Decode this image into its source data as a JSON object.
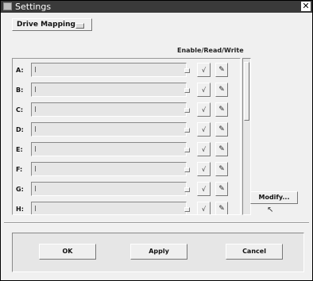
{
  "window": {
    "title": "Settings",
    "close_glyph": "✕"
  },
  "option_menu": {
    "label": "Drive Mapping"
  },
  "column_header": "Enable/Read/Write",
  "drives": [
    {
      "letter": "A:",
      "ro": "√",
      "rw": "✎"
    },
    {
      "letter": "B:",
      "ro": "√",
      "rw": "✎"
    },
    {
      "letter": "C:",
      "ro": "√",
      "rw": "✎"
    },
    {
      "letter": "D:",
      "ro": "√",
      "rw": "✎"
    },
    {
      "letter": "E:",
      "ro": "√",
      "rw": "✎"
    },
    {
      "letter": "F:",
      "ro": "√",
      "rw": "✎"
    },
    {
      "letter": "G:",
      "ro": "√",
      "rw": "✎"
    },
    {
      "letter": "H:",
      "ro": "√",
      "rw": "✎"
    }
  ],
  "modify_label": "Modify...",
  "buttons": {
    "ok": "OK",
    "apply": "Apply",
    "cancel": "Cancel"
  }
}
